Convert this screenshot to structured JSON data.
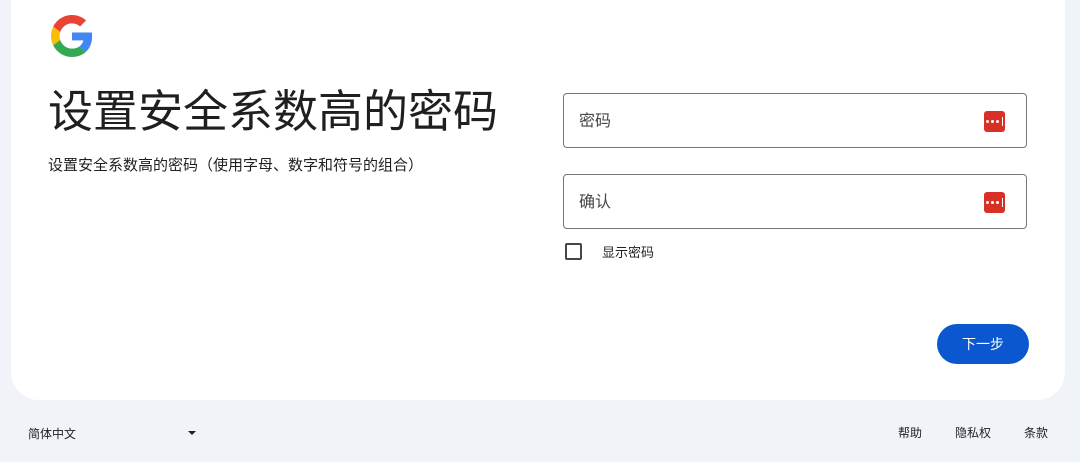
{
  "header": {
    "logo_icon": "google-g-logo",
    "title": "设置安全系数高的密码",
    "subtitle": "设置安全系数高的密码（使用字母、数字和符号的组合）"
  },
  "form": {
    "password_placeholder": "密码",
    "confirm_placeholder": "确认",
    "password_manager_icon": "password-key-icon",
    "show_password_label": "显示密码",
    "show_password_checked": false,
    "next_label": "下一步"
  },
  "footer": {
    "language": "简体中文",
    "links": [
      "帮助",
      "隐私权",
      "条款"
    ]
  },
  "colors": {
    "primary": "#0b57d0",
    "icon_red": "#d93025",
    "background": "#f0f4f9",
    "card": "#ffffff"
  }
}
